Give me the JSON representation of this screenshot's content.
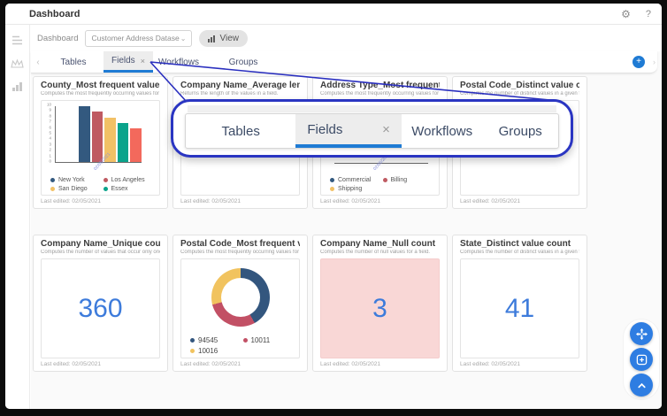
{
  "window": {
    "title": "Dashboard",
    "help_label": "?"
  },
  "toolbar": {
    "context_label": "Dashboard",
    "dataset_value": "Customer Address Datase",
    "view_label": "View"
  },
  "tabs": {
    "close_glyph": "×",
    "items": [
      {
        "label": "Tables",
        "active": false
      },
      {
        "label": "Fields",
        "active": true,
        "closable": true
      },
      {
        "label": "Workflows",
        "active": false
      },
      {
        "label": "Groups",
        "active": false
      }
    ]
  },
  "callout": {
    "active": "Fields",
    "close_glyph": "×",
    "items": [
      "Tables",
      "Fields",
      "Workflows",
      "Groups"
    ]
  },
  "cards": [
    {
      "title": "County_Most frequent values",
      "subtitle": "Computes the most frequently occurring values for a field.",
      "footer": "Last edited: 02/05/2021",
      "chart": {
        "type": "bar",
        "ymax": 10,
        "x_date_label": "02/05/2021",
        "series": [
          {
            "label": "New York",
            "value": 10,
            "color": "#33597f"
          },
          {
            "label": "Los Angeles",
            "value": 9,
            "color": "#bf5a62"
          },
          {
            "label": "San Diego",
            "value": 8,
            "color": "#f2c166"
          },
          {
            "label": "Essex",
            "value": 7,
            "color": "#0aa38b"
          },
          {
            "label": "",
            "value": 6,
            "color": "#f3695c"
          }
        ],
        "legend": [
          {
            "label": "New York",
            "color": "#33597f"
          },
          {
            "label": "Los Angeles",
            "color": "#bf5a62"
          },
          {
            "label": "San Diego",
            "color": "#f2c166"
          },
          {
            "label": "Essex",
            "color": "#0aa38b"
          }
        ]
      }
    },
    {
      "title": "Company Name_Average length",
      "subtitle": "Returns the length of the values in a field.",
      "footer": "Last edited: 02/05/2021"
    },
    {
      "title": "Address Type_Most frequent values",
      "subtitle": "Computes the most frequently occurring values for a field.",
      "footer": "Last edited: 02/05/2021",
      "x_date_label": "02/05/2021",
      "legend": [
        {
          "label": "Commercial",
          "color": "#33597f"
        },
        {
          "label": "Billing",
          "color": "#bf5a62"
        },
        {
          "label": "Shipping",
          "color": "#f2c166"
        }
      ]
    },
    {
      "title": "Postal Code_Distinct value count",
      "subtitle": "Computes the number of distinct values in a given field.",
      "footer": "Last edited: 02/05/2021"
    },
    {
      "title": "Company Name_Unique count",
      "subtitle": "Computes the number of values that occur only once.",
      "footer": "Last edited: 02/05/2021",
      "value": "360"
    },
    {
      "title": "Postal Code_Most frequent values",
      "subtitle": "Computes the most frequently occurring values for a field.",
      "footer": "Last edited: 02/05/2021",
      "donut": {
        "segments": [
          {
            "label": "94545",
            "pct": 42,
            "color": "#33567e"
          },
          {
            "label": "10011",
            "pct": 29,
            "color": "#c25065"
          },
          {
            "label": "10016",
            "pct": 29,
            "color": "#f1c35f"
          }
        ]
      }
    },
    {
      "title": "Company Name_Null count",
      "subtitle": "Computes the number of null values for a field.",
      "footer": "Last edited: 02/05/2021",
      "value": "3",
      "highlight_bg": "#f9d7d6"
    },
    {
      "title": "State_Distinct value count",
      "subtitle": "Computes the number of distinct values in a given field.",
      "footer": "Last edited: 02/05/2021",
      "value": "41"
    }
  ],
  "colors": {
    "accent": "#1f7bd4",
    "big_number": "#3d7bdb",
    "callout_border": "#2a35c2",
    "connector": "#2a2fbf",
    "fab": "#2e7de2"
  }
}
